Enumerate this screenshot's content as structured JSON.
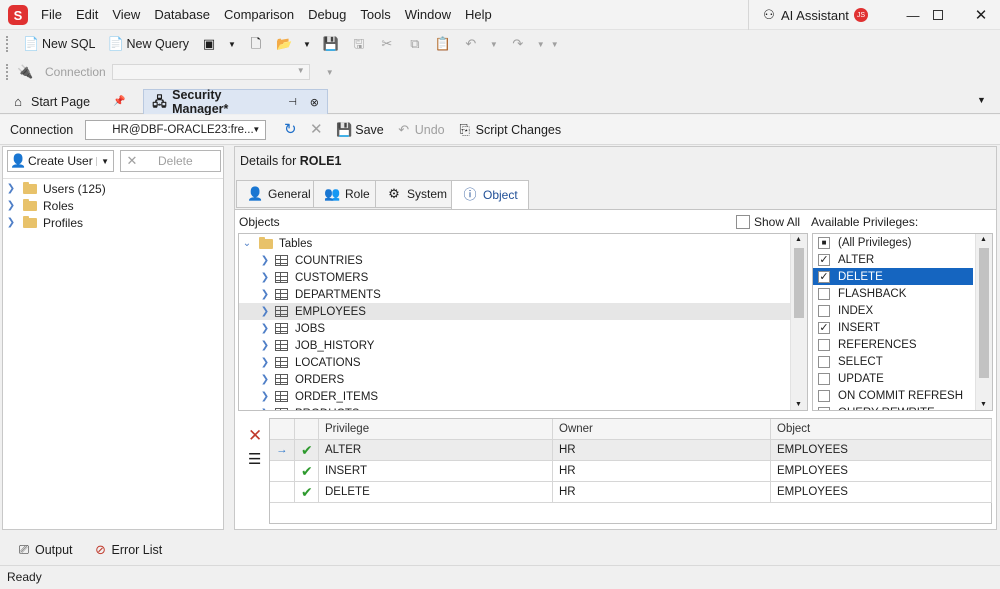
{
  "menu": [
    "File",
    "Edit",
    "View",
    "Database",
    "Comparison",
    "Debug",
    "Tools",
    "Window",
    "Help"
  ],
  "app_logo_letter": "S",
  "ai_assistant": "AI Assistant",
  "user_initials": "JS",
  "toolbar": {
    "new_sql": "New SQL",
    "new_query": "New Query"
  },
  "toolbar2": {
    "connection_label": "Connection"
  },
  "doc_tabs": [
    {
      "label": "Start Page"
    },
    {
      "label": "Security Manager*"
    }
  ],
  "sec_toolbar": {
    "connection_label": "Connection",
    "connection_value": "HR@DBF-ORACLE23:fre...",
    "save": "Save",
    "undo": "Undo",
    "script_changes": "Script Changes"
  },
  "left": {
    "create_user": "Create User",
    "delete": "Delete",
    "tree": [
      {
        "label": "Users (125)"
      },
      {
        "label": "Roles"
      },
      {
        "label": "Profiles"
      }
    ]
  },
  "details": {
    "prefix": "Details for",
    "role": "ROLE1"
  },
  "tabs": [
    {
      "label": "General"
    },
    {
      "label": "Role"
    },
    {
      "label": "System"
    },
    {
      "label": "Object"
    }
  ],
  "objects": {
    "label": "Objects",
    "show_all": "Show All",
    "root": "Tables",
    "items": [
      "COUNTRIES",
      "CUSTOMERS",
      "DEPARTMENTS",
      "EMPLOYEES",
      "JOBS",
      "JOB_HISTORY",
      "LOCATIONS",
      "ORDERS",
      "ORDER_ITEMS",
      "PRODUCTS"
    ],
    "selected": "EMPLOYEES"
  },
  "privileges": {
    "label": "Available Privileges:",
    "items": [
      {
        "label": "(All Privileges)",
        "state": "partial"
      },
      {
        "label": "ALTER",
        "state": "checked"
      },
      {
        "label": "DELETE",
        "state": "checked",
        "selected": true
      },
      {
        "label": "FLASHBACK",
        "state": "unchecked"
      },
      {
        "label": "INDEX",
        "state": "unchecked"
      },
      {
        "label": "INSERT",
        "state": "checked"
      },
      {
        "label": "REFERENCES",
        "state": "unchecked"
      },
      {
        "label": "SELECT",
        "state": "unchecked"
      },
      {
        "label": "UPDATE",
        "state": "unchecked"
      },
      {
        "label": "ON COMMIT REFRESH",
        "state": "unchecked"
      },
      {
        "label": "QUERY REWRITE",
        "state": "unchecked"
      }
    ]
  },
  "grid": {
    "columns": [
      "Privilege",
      "Owner",
      "Object"
    ],
    "rows": [
      {
        "privilege": "ALTER",
        "owner": "HR",
        "object": "EMPLOYEES"
      },
      {
        "privilege": "INSERT",
        "owner": "HR",
        "object": "EMPLOYEES"
      },
      {
        "privilege": "DELETE",
        "owner": "HR",
        "object": "EMPLOYEES"
      }
    ]
  },
  "bottom": {
    "output": "Output",
    "error_list": "Error List"
  },
  "status": "Ready",
  "colors": {
    "accent": "#1565c0",
    "logo": "#e03131",
    "check": "#2e9a2e",
    "delete_x": "#c0392b"
  }
}
